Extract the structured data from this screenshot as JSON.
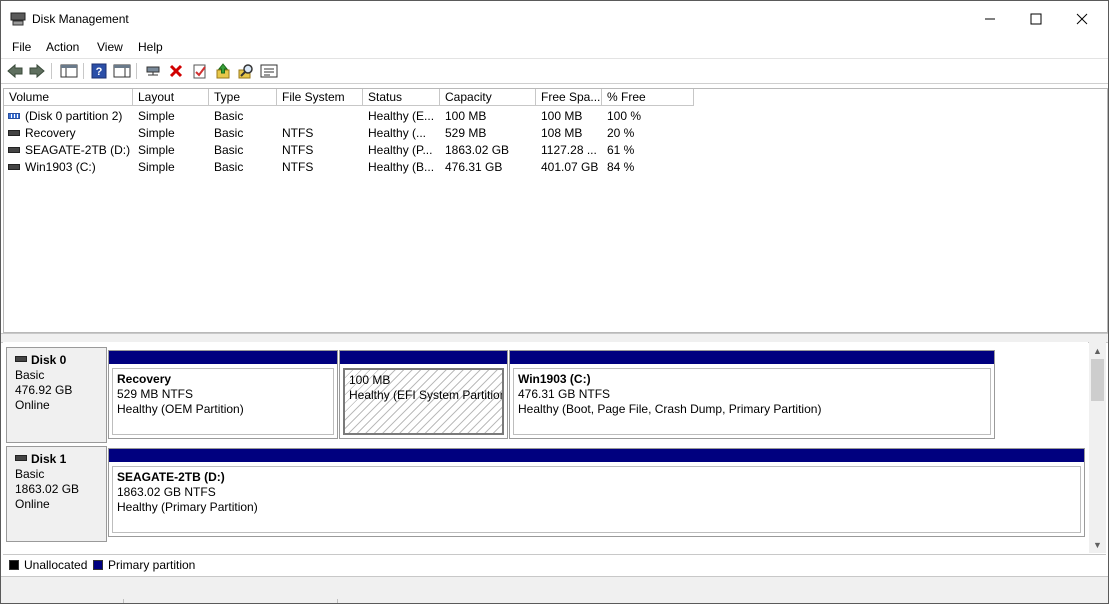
{
  "window": {
    "title": "Disk Management"
  },
  "menu": [
    "File",
    "Action",
    "View",
    "Help"
  ],
  "toolbar": [
    "back-icon",
    "forward-icon",
    "show-hide-console-tree-icon",
    "help-icon",
    "properties-pane-icon",
    "connect-icon",
    "delete-icon",
    "properties-icon",
    "up-icon",
    "find-icon",
    "settings-icon"
  ],
  "volume_table": {
    "columns": [
      "Volume",
      "Layout",
      "Type",
      "File System",
      "Status",
      "Capacity",
      "Free Spa...",
      "% Free"
    ],
    "rows": [
      {
        "volume": "(Disk 0 partition 2)",
        "layout": "Simple",
        "type": "Basic",
        "fs": "",
        "status": "Healthy (E...",
        "capacity": "100 MB",
        "free": "100 MB",
        "pct": "100 %"
      },
      {
        "volume": "Recovery",
        "layout": "Simple",
        "type": "Basic",
        "fs": "NTFS",
        "status": "Healthy (...",
        "capacity": "529 MB",
        "free": "108 MB",
        "pct": "20 %"
      },
      {
        "volume": "SEAGATE-2TB (D:)",
        "layout": "Simple",
        "type": "Basic",
        "fs": "NTFS",
        "status": "Healthy (P...",
        "capacity": "1863.02 GB",
        "free": "1127.28 ...",
        "pct": "61 %"
      },
      {
        "volume": "Win1903 (C:)",
        "layout": "Simple",
        "type": "Basic",
        "fs": "NTFS",
        "status": "Healthy (B...",
        "capacity": "476.31 GB",
        "free": "401.07 GB",
        "pct": "84 %"
      }
    ]
  },
  "disks": [
    {
      "name": "Disk 0",
      "type": "Basic",
      "size": "476.92 GB",
      "state": "Online",
      "partitions": [
        {
          "title": "Recovery",
          "size": "529 MB NTFS",
          "status": "Healthy (OEM Partition)"
        },
        {
          "title": "",
          "size": "100 MB",
          "status": "Healthy (EFI System Partition)"
        },
        {
          "title": "Win1903  (C:)",
          "size": "476.31 GB NTFS",
          "status": "Healthy (Boot, Page File, Crash Dump, Primary Partition)"
        }
      ]
    },
    {
      "name": "Disk 1",
      "type": "Basic",
      "size": "1863.02 GB",
      "state": "Online",
      "partitions": [
        {
          "title": "SEAGATE-2TB  (D:)",
          "size": "1863.02 GB NTFS",
          "status": "Healthy (Primary Partition)"
        }
      ]
    }
  ],
  "legend": [
    {
      "label": "Unallocated",
      "color": "#000000"
    },
    {
      "label": "Primary partition",
      "color": "#00007f"
    }
  ],
  "colors": {
    "partition_bar": "#00007f",
    "delete": "#d00000"
  }
}
